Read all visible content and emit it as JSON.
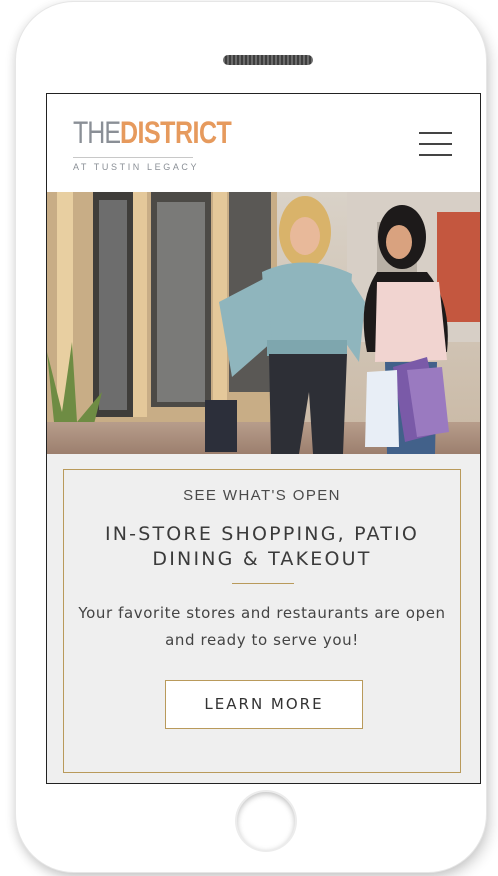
{
  "logo": {
    "the": "THE",
    "district": "DISTRICT",
    "subtitle": "AT TUSTIN LEGACY"
  },
  "icons": {
    "menu": "hamburger-menu-icon"
  },
  "promo": {
    "eyebrow": "SEE WHAT'S OPEN",
    "heading": "IN-STORE SHOPPING, PATIO DINING & TAKEOUT",
    "body": "Your favorite stores and restaurants are open and ready to serve you!",
    "cta_label": "LEARN MORE"
  },
  "colors": {
    "accent_gold": "#b99a5b",
    "logo_orange": "#e69a5d",
    "logo_gray": "#8a8f96",
    "panel_bg": "#efefef"
  }
}
